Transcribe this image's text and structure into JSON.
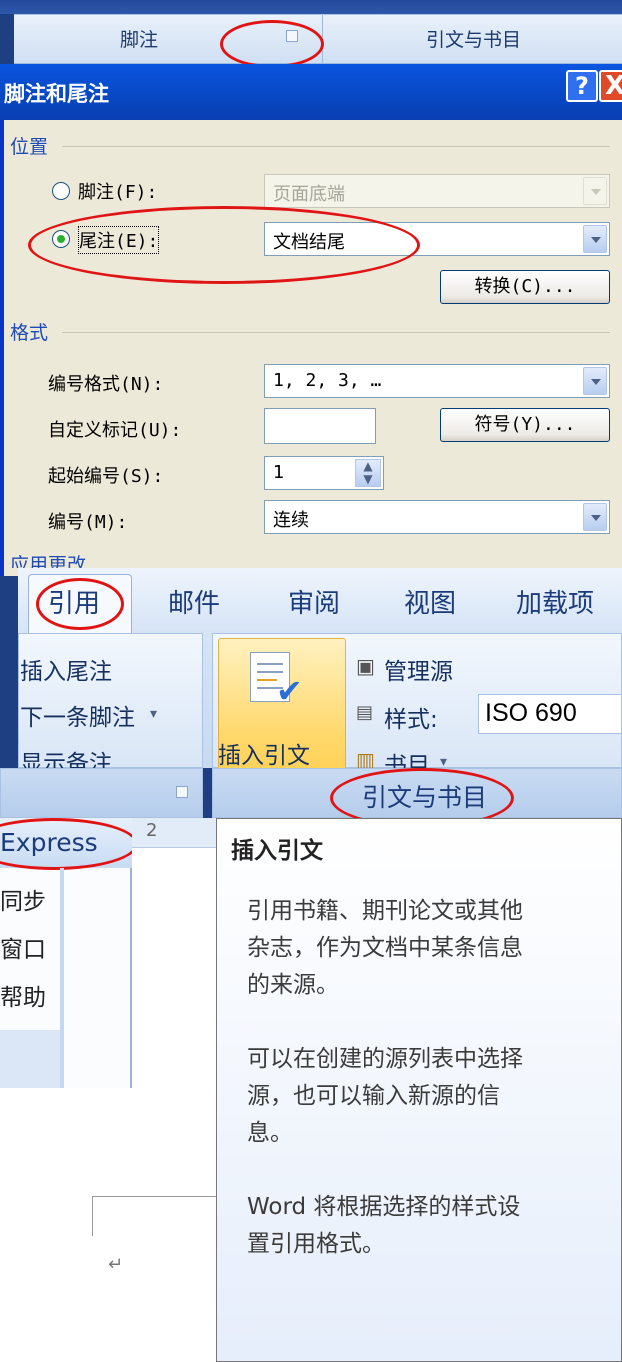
{
  "ribbon_top": {
    "group_footnotes": "脚注",
    "group_citations": "引文与书目"
  },
  "dialog": {
    "title": "脚注和尾注",
    "help": "?",
    "close": "X",
    "location": {
      "section": "位置",
      "footnote_label": "脚注(F):",
      "footnote_value": "页面底端",
      "endnote_label": "尾注(E):",
      "endnote_value": "文档结尾",
      "selected": "endnote",
      "convert_button": "转换(C)..."
    },
    "format": {
      "section": "格式",
      "number_format_label": "编号格式(N):",
      "number_format_value": "1, 2, 3, …",
      "custom_mark_label": "自定义标记(U):",
      "custom_mark_value": "",
      "symbol_button": "符号(Y)...",
      "start_at_label": "起始编号(S):",
      "start_at_value": "1",
      "numbering_label": "编号(M):",
      "numbering_value": "连续"
    },
    "apply_section": "应用更改"
  },
  "ribbon": {
    "tabs": [
      "引用",
      "邮件",
      "审阅",
      "视图",
      "加载项"
    ],
    "active_tab": "引用",
    "footnotes_group": {
      "insert_endnote": "插入尾注",
      "next_footnote": "下一条脚注",
      "show_notes": "显示备注"
    },
    "citations_group": {
      "insert_citation": "插入引文",
      "manage_sources": "管理源",
      "style_label": "样式:",
      "style_value": "ISO 690",
      "bibliography": "书目",
      "group_label": "引文与书目"
    }
  },
  "left_menu": {
    "header": "Express",
    "items": [
      "同步",
      "窗口",
      "帮助"
    ]
  },
  "ruler": {
    "mark": "2"
  },
  "tooltip": {
    "title": "插入引文",
    "para1": [
      "引用书籍、期刊论文或其他",
      "杂志，作为文档中某条信息",
      "的来源。"
    ],
    "para2": [
      "可以在创建的源列表中选择",
      "源，也可以输入新源的信",
      "息。"
    ],
    "para3": [
      "Word 将根据选择的样式设",
      "置引用格式。"
    ]
  },
  "colors": {
    "highlight_ellipse": "#e01414",
    "dialog_title": "#0a55e0",
    "ribbon_text": "#1b3c79"
  }
}
